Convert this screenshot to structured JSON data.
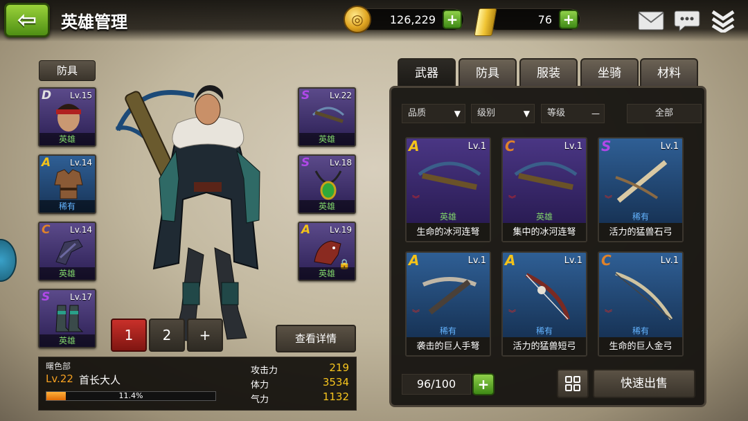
{
  "header": {
    "title": "英雄管理",
    "back_icon": "back-arrow-icon",
    "coins": "126,229",
    "gold": "76"
  },
  "colors": {
    "grade_S": "#b048e8",
    "grade_A": "#f3c21a",
    "grade_C": "#e0822a",
    "grade_D": "#e0e0e0",
    "rarity_hero": "#7fd36a",
    "rarity_rare": "#64b4ff",
    "hero_bg": "#3b2a6e",
    "rare_bg": "#1d3e66"
  },
  "left_gear": {
    "header": "防具",
    "slots": [
      {
        "grade": "D",
        "level": "Lv.15",
        "rarity": "英雄"
      },
      {
        "grade": "A",
        "level": "Lv.14",
        "rarity": "稀有"
      },
      {
        "grade": "C",
        "level": "Lv.14",
        "rarity": "英雄"
      },
      {
        "grade": "S",
        "level": "Lv.17",
        "rarity": "英雄"
      }
    ]
  },
  "right_gear": {
    "slots": [
      {
        "grade": "S",
        "level": "Lv.22",
        "rarity": "英雄"
      },
      {
        "grade": "S",
        "level": "Lv.18",
        "rarity": "英雄"
      },
      {
        "grade": "A",
        "level": "Lv.19",
        "rarity": "英雄"
      }
    ]
  },
  "pages": {
    "p1": "1",
    "p2": "2",
    "add": "+"
  },
  "details_button": "查看详情",
  "hero": {
    "class_name": "曙色部",
    "level": "Lv.22",
    "rank": "首长大人",
    "xp_percent_text": "11.4%",
    "xp_fraction": 0.114,
    "stats": [
      {
        "label": "攻击力",
        "value": "219"
      },
      {
        "label": "体力",
        "value": "3534"
      },
      {
        "label": "气力",
        "value": "1132"
      }
    ]
  },
  "inventory": {
    "tabs": [
      "武器",
      "防具",
      "服装",
      "坐骑",
      "材料"
    ],
    "filters": {
      "quality": "品质",
      "grade": "级别",
      "level": "等级",
      "level_dash": "—",
      "all": "全部"
    },
    "items": [
      {
        "grade": "A",
        "level": "Lv.1",
        "rarity": "英雄",
        "name": "生命的冰河连弩"
      },
      {
        "grade": "C",
        "level": "Lv.1",
        "rarity": "英雄",
        "name": "集中的冰河连弩"
      },
      {
        "grade": "S",
        "level": "Lv.1",
        "rarity": "稀有",
        "name": "活力的猛兽石弓"
      },
      {
        "grade": "A",
        "level": "Lv.1",
        "rarity": "稀有",
        "name": "袭击的巨人手弩"
      },
      {
        "grade": "A",
        "level": "Lv.1",
        "rarity": "稀有",
        "name": "活力的猛兽短弓"
      },
      {
        "grade": "C",
        "level": "Lv.1",
        "rarity": "稀有",
        "name": "生命的巨人金弓"
      }
    ],
    "count": "96/100",
    "sell_button": "快速出售"
  }
}
